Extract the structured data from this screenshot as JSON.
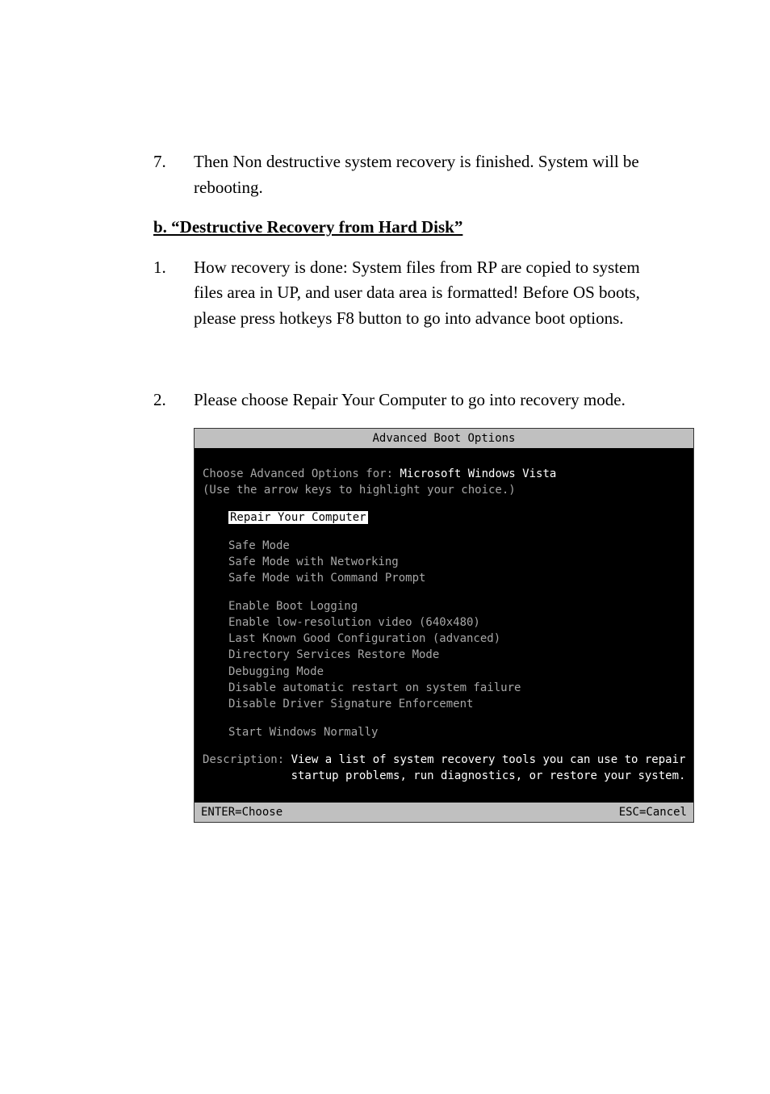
{
  "list7": {
    "num": "7.",
    "text": "Then Non destructive system recovery is finished. System will be rebooting."
  },
  "sectionB": "b.  “Destructive Recovery from Hard Disk”",
  "list1": {
    "num": "1.",
    "text": "How recovery is done:  System files from RP are copied to system files area in UP, and user data area is formatted! Before OS boots, please press hotkeys F8 button to go into advance boot options."
  },
  "list2": {
    "num": "2.",
    "text": "Please choose Repair Your Computer to go into recovery mode."
  },
  "boot": {
    "title": "Advanced Boot Options",
    "chooseFor": "Choose Advanced Options for: ",
    "osName": "Microsoft Windows Vista",
    "hint": "(Use the arrow keys to highlight your choice.)",
    "selected": "Repair Your Computer",
    "options": {
      "safe": "Safe Mode",
      "safeNet": "Safe Mode with Networking",
      "safeCmd": "Safe Mode with Command Prompt",
      "bootLog": "Enable Boot Logging",
      "lowRes": "Enable low-resolution video (640x480)",
      "lkgc": "Last Known Good Configuration (advanced)",
      "dsrm": "Directory Services Restore Mode",
      "debug": "Debugging Mode",
      "noAutoRestart": "Disable automatic restart on system failure",
      "noDriverSig": "Disable Driver Signature Enforcement",
      "startNormal": "Start Windows Normally"
    },
    "descLabel": "Description: ",
    "desc1": "View a list of system recovery tools you can use to repair",
    "desc2": "startup problems, run diagnostics, or restore your system.",
    "footerLeft": "ENTER=Choose",
    "footerRight": "ESC=Cancel"
  }
}
